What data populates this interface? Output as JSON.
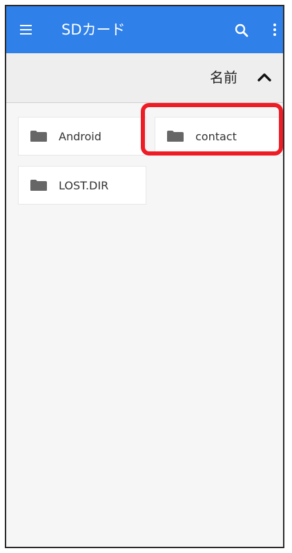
{
  "appbar": {
    "title": "SDカード",
    "menu_icon": "menu-icon",
    "search_icon": "search-icon",
    "more_icon": "more-vert-icon",
    "color": "#2f80e8"
  },
  "sortbar": {
    "label": "名前",
    "direction_icon": "chevron-up-icon"
  },
  "files": [
    {
      "name": "Android",
      "icon": "folder-icon"
    },
    {
      "name": "contact",
      "icon": "folder-icon"
    },
    {
      "name": "LOST.DIR",
      "icon": "folder-icon"
    }
  ],
  "annotation": {
    "color": "#ee1c25"
  }
}
